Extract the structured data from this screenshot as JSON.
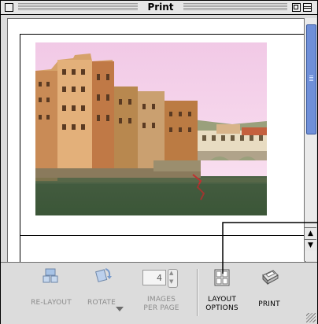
{
  "window": {
    "title": "Print"
  },
  "toolbar": {
    "relayout_label": "RE-LAYOUT",
    "rotate_label": "ROTATE",
    "images_value": "4",
    "images_label_1": "IMAGES",
    "images_label_2": "PER PAGE",
    "layout_label_1": "LAYOUT",
    "layout_label_2": "OPTIONS",
    "print_label": "PRINT"
  },
  "icons": {
    "relayout": "relayout-icon",
    "rotate": "rotate-icon",
    "layout_options": "layout-grid-icon",
    "print": "printer-icon"
  },
  "colors": {
    "scroll_thumb": "#6f8fd8",
    "disabled_text": "#8c8c8c"
  }
}
